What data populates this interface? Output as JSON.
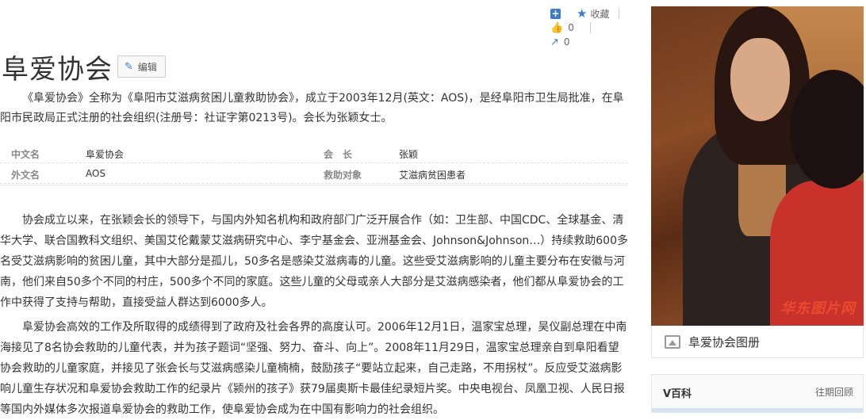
{
  "actions": {
    "add_label": "+",
    "collect_label": "收藏",
    "like_count": "0",
    "share_count": "0"
  },
  "title": "阜爱协会",
  "edit_label": "编辑",
  "lead": "《阜爱协会》全称为《阜阳市艾滋病贫困儿童救助协会》，成立于2003年12月(英文：AOS)，是经阜阳市卫生局批准，在阜阳市民政局正式注册的社会组织(注册号：社证字第0213号)。会长为张颖女士。",
  "basic_info": [
    {
      "k1": "中文名",
      "v1": "阜爱协会",
      "k2": "会　长",
      "v2": "张颖"
    },
    {
      "k1": "外文名",
      "v1": "AOS",
      "k2": "救助对象",
      "v2": "艾滋病贫困患者"
    }
  ],
  "paragraphs": [
    "协会成立以来，在张颖会长的领导下，与国内外知名机构和政府部门广泛开展合作（如：卫生部、中国CDC、全球基金、清华大学、联合国教科文组织、美国艾伦戴蒙艾滋病研究中心、李宁基金会、亚洲基金会、Johnson&Johnson…）持续救助600多名受艾滋病影响的贫困儿童，其中大部分是孤儿，50多名是感染艾滋病毒的儿童。这些受艾滋病影响的儿童主要分布在安徽与河南，他们来自50多个不同的村庄，500多个不同的家庭。这些儿童的父母或亲人大部分是艾滋病感染者，他们都从阜爱协会的工作中获得了支持与帮助，直接受益人群达到6000多人。",
    "阜爱协会高效的工作及所取得的成绩得到了政府及社会各界的高度认可。2006年12月1日，温家宝总理，吴仪副总理在中南海接见了8名协会救助的儿童代表，并为孩子题词“坚强、努力、奋斗、向上”。2008年11月29日，温家宝总理亲自到阜阳看望协会救助的儿童家庭，并接见了张会长与艾滋病感染儿童楠楠，鼓励孩子“要站立起来，自己走路，不用拐杖”。反应受艾滋病影响儿童生存状况和阜爱协会救助工作的纪录片《颍州的孩子》获79届奥斯卡最佳纪录短片奖。中央电视台、凤凰卫视、人民日报等国内外媒体多次报道阜爱协会的救助工作，使阜爱协会成为在中国有影响力的社会组织。"
  ],
  "sidebar": {
    "photo_watermark": "华东图片网",
    "gallery_label": "阜爱协会图册",
    "vbox_title": "V百科",
    "vbox_more": "往期回顾"
  },
  "colors": {
    "accent": "#3a7cc8",
    "text": "#333333",
    "muted": "#888888"
  }
}
